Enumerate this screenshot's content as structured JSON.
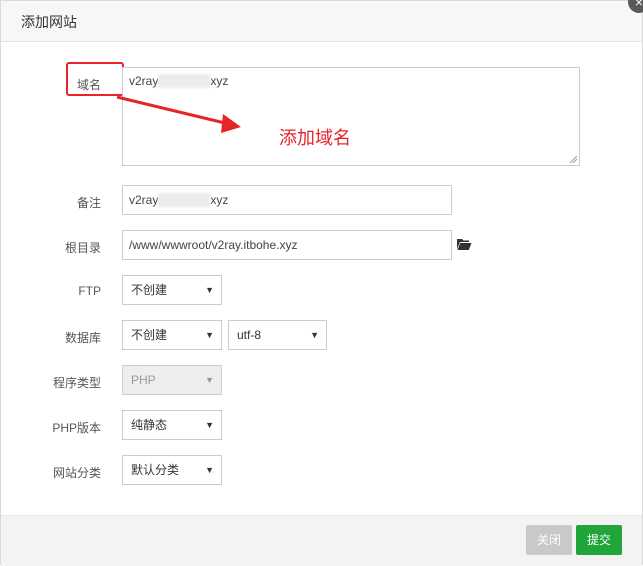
{
  "dialog": {
    "title": "添加网站",
    "close_glyph": "×"
  },
  "form": {
    "domain_label": "域名",
    "domain_value_prefix": "v2ray",
    "domain_value_suffix": "xyz",
    "remark_label": "备注",
    "remark_value_prefix": "v2ray",
    "remark_value_suffix": "xyz",
    "root_label": "根目录",
    "root_value": "/www/wwwroot/v2ray.itbohe.xyz",
    "ftp_label": "FTP",
    "ftp_value": "不创建",
    "db_label": "数据库",
    "db_value": "不创建",
    "db_charset": "utf-8",
    "program_type_label": "程序类型",
    "program_type_value": "PHP",
    "php_version_label": "PHP版本",
    "php_version_value": "纯静态",
    "site_category_label": "网站分类",
    "site_category_value": "默认分类"
  },
  "annotation": {
    "text": "添加域名",
    "color": "#e8232a"
  },
  "footer": {
    "close_label": "关闭",
    "submit_label": "提交"
  },
  "icons": {
    "folder": "folder-open-icon",
    "caret": "caret-down-icon",
    "resize": "resize-grip-icon"
  },
  "colors": {
    "accent_green": "#20a53a",
    "disabled_gray": "#c9c9c9"
  }
}
